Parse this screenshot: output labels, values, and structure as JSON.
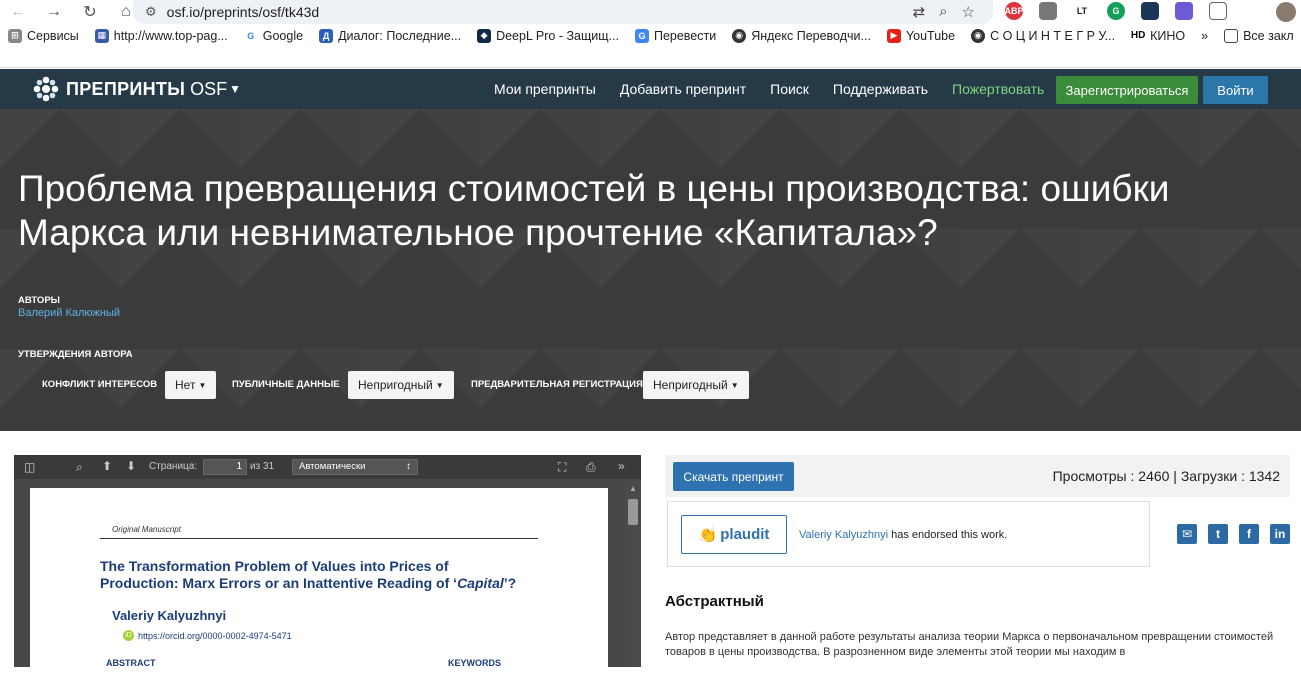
{
  "browser": {
    "url": "osf.io/preprints/osf/tk43d",
    "bookmarks": [
      "Сервисы",
      "http://www.top-pag...",
      "Google",
      "Диалог: Последние...",
      "DeepL Pro - Защищ...",
      "Перевести",
      "Яндекс Переводчи...",
      "YouTube",
      "С О Ц И Н Т Е Г Р У...",
      "КИНО",
      "Все закл"
    ],
    "extensions": [
      "ABP",
      "",
      "LT",
      "G",
      "",
      "",
      ""
    ]
  },
  "navbar": {
    "brand": "ПРЕПРИНТЫ",
    "brand_suffix": "OSF",
    "links": [
      "Мои препринты",
      "Добавить препринт",
      "Поиск",
      "Поддерживать",
      "Пожертвовать"
    ],
    "register": "Зарегистрироваться",
    "login": "Войти"
  },
  "preprint": {
    "title": "Проблема превращения стоимостей в цены производства: ошибки Маркса или невнимательное прочтение «Капитала»?",
    "authors_label": "АВТОРЫ",
    "author": "Валерий Калюжный",
    "assertions_label": "УТВЕРЖДЕНИЯ АВТОРА",
    "coi_label": "КОНФЛИКТ ИНТЕРЕСОВ",
    "coi_value": "Нет",
    "data_label": "ПУБЛИЧНЫЕ ДАННЫЕ",
    "data_value": "Непригодный",
    "prereg_label": "ПРЕДВАРИТЕЛЬНАЯ РЕГИСТРАЦИЯ",
    "prereg_value": "Непригодный"
  },
  "pdf": {
    "page_label": "Страница:",
    "page_number": "1",
    "page_total": "из 31",
    "zoom": "Автоматически",
    "manuscript": "Original Manuscript",
    "title_line1": "The Transformation Problem of Values into Prices of",
    "title_line2": "Production: Marx Errors or an Inattentive Reading of",
    "title_ital": "Capital",
    "author": "Valeriy Kalyuzhnyi",
    "orcid": "https://orcid.org/0000-0002-4974-5471",
    "abstract_h": "ABSTRACT",
    "keywords_h": "KEYWORDS"
  },
  "sidebar": {
    "download": "Скачать препринт",
    "stats": "Просмотры : 2460 | Загрузки : 1342",
    "plaudit": "plaudit",
    "endorser": "Valeriy Kalyuzhnyi",
    "endorse_text": " has endorsed this work.",
    "abstract_heading": "Абстрактный",
    "abstract_text": "Автор представляет в данной работе результаты анализа теории Маркса о первоначальном превращении стоимостей товаров в цены производства. В разрозненном виде элементы этой теории мы находим в"
  },
  "colors": {
    "navbar": "#263947",
    "hero": "#3b3b3b",
    "register": "#3a8b3a",
    "login": "#2b77a9",
    "download": "#2f72b0",
    "link": "#5fb3e6"
  }
}
